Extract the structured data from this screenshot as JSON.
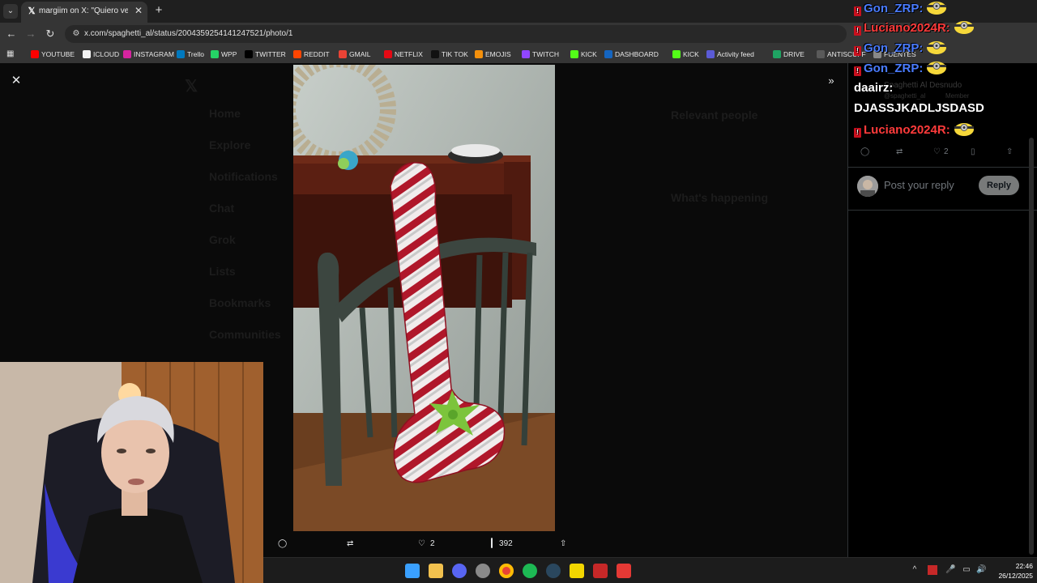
{
  "browser": {
    "tab_title": "margiim on X: \"Quiero ver que",
    "tab_close": "✕",
    "new_tab": "+",
    "url": "x.com/spaghetti_al/status/2004359254141247521/photo/1"
  },
  "bookmarks": [
    {
      "label": "YOUTUBE",
      "icon": "youtube-icon",
      "color": "#ff0000"
    },
    {
      "label": "ICLOUD",
      "icon": "icloud-icon",
      "color": "#f2f2f2"
    },
    {
      "label": "INSTAGRAM",
      "icon": "instagram-icon",
      "color": "#d6249f"
    },
    {
      "label": "Trello",
      "icon": "trello-icon",
      "color": "#0079bf"
    },
    {
      "label": "WPP",
      "icon": "whatsapp-icon",
      "color": "#25d366"
    },
    {
      "label": "TWITTER",
      "icon": "x-icon",
      "color": "#000000"
    },
    {
      "label": "REDDIT",
      "icon": "reddit-icon",
      "color": "#ff4500"
    },
    {
      "label": "GMAIL",
      "icon": "gmail-icon",
      "color": "#ea4335"
    },
    {
      "label": "NETFLIX",
      "icon": "netflix-icon",
      "color": "#e50914"
    },
    {
      "label": "TIK TOK",
      "icon": "tiktok-icon",
      "color": "#111111"
    },
    {
      "label": "EMOJIS",
      "icon": "emoji-icon",
      "color": "#f4900c"
    },
    {
      "label": "TWITCH",
      "icon": "twitch-icon",
      "color": "#9146ff"
    },
    {
      "label": "KICK",
      "icon": "kick-icon",
      "color": "#53fc18"
    },
    {
      "label": "DASHBOARD",
      "icon": "dashboard-icon",
      "color": "#1565c0"
    },
    {
      "label": "KICK",
      "icon": "kick-icon",
      "color": "#53fc18"
    },
    {
      "label": "Activity feed",
      "icon": "activity-feed-icon",
      "color": "#5b5bd6"
    },
    {
      "label": "DRIVE",
      "icon": "drive-icon",
      "color": "#1fa463"
    },
    {
      "label": "ANTISCUFF",
      "icon": "antiscuff-icon",
      "color": "#5a5a5a"
    },
    {
      "label": "FUENTES",
      "icon": "globe-icon",
      "color": "#888888"
    }
  ],
  "viewer": {
    "close": "✕",
    "expand": "»",
    "likes": "2",
    "views": "392"
  },
  "chat": [
    {
      "user": "Gon_ZRP:",
      "color": "#4a7cff",
      "badge": true,
      "emote": true
    },
    {
      "user": "Luciano2024R:",
      "color": "#ff3b3b",
      "badge": true,
      "emote": true
    },
    {
      "user": "Gon_ZRP:",
      "color": "#4a7cff",
      "badge": true,
      "emote": true
    },
    {
      "user": "Gon_ZRP:",
      "color": "#4a7cff",
      "badge": true,
      "emote": true
    },
    {
      "user": "daairz:",
      "color": "#ffffff",
      "badge": false,
      "emote": false
    },
    {
      "user": "DJASSJKADLJSDASD",
      "color": "#ffffff",
      "badge": false,
      "emote": false
    },
    {
      "user": "Luciano2024R:",
      "color": "#ff3b3b",
      "badge": true,
      "emote": true
    }
  ],
  "profile_ghost": {
    "name": "Spaghetti Al Desnudo",
    "handle": "@spaghetti_al",
    "member": "Member"
  },
  "post_actions": {
    "likes": "2"
  },
  "reply": {
    "placeholder": "Post your reply",
    "button": "Reply"
  },
  "background_ghost": {
    "nav": [
      "Home",
      "Explore",
      "Notifications",
      "Chat",
      "Grok",
      "Lists",
      "Bookmarks",
      "Communities"
    ],
    "relevant": "Relevant people",
    "happening": "What's happening"
  },
  "taskbar": {
    "time": "22:46",
    "date": "26/12/2025"
  }
}
